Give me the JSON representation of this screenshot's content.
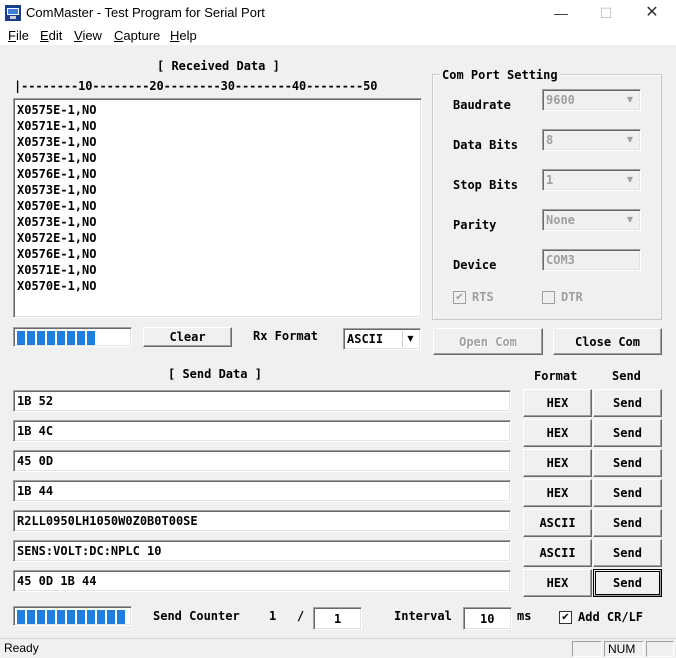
{
  "window": {
    "title": "ComMaster - Test Program for Serial Port",
    "min_glyph": "—",
    "max_glyph": "☐",
    "close_glyph": "✕",
    "icon": "serial-app-icon"
  },
  "menu": [
    {
      "accel": "F",
      "rest": "ile"
    },
    {
      "accel": "E",
      "rest": "dit"
    },
    {
      "accel": "V",
      "rest": "iew"
    },
    {
      "accel": "C",
      "rest": "apture"
    },
    {
      "accel": "H",
      "rest": "elp"
    }
  ],
  "received": {
    "heading": "[ Received Data ]",
    "ruler": "|--------10--------20--------30--------40--------50",
    "lines": [
      "X0575E-1,NO",
      "X0571E-1,NO",
      "X0573E-1,NO",
      "X0573E-1,NO",
      "X0576E-1,NO",
      "X0573E-1,NO",
      "X0570E-1,NO",
      "X0573E-1,NO",
      "X0572E-1,NO",
      "X0576E-1,NO",
      "X0571E-1,NO",
      "X0570E-1,NO"
    ],
    "progress": 0.72,
    "clear_label": "Clear",
    "rx_format_label": "Rx Format",
    "rx_format_value": "ASCII"
  },
  "com_port": {
    "group_title": "Com Port Setting",
    "baudrate_label": "Baudrate",
    "baudrate_value": "9600",
    "data_bits_label": "Data Bits",
    "data_bits_value": "8",
    "stop_bits_label": "Stop Bits",
    "stop_bits_value": "1",
    "parity_label": "Parity",
    "parity_value": "None",
    "device_label": "Device",
    "device_value": "COM3",
    "rts_label": "RTS",
    "rts_checked": true,
    "dtr_label": "DTR",
    "dtr_checked": false,
    "open_label": "Open Com",
    "close_label": "Close Com"
  },
  "send": {
    "heading": "[ Send Data ]",
    "format_header": "Format",
    "send_header": "Send",
    "rows": [
      {
        "data": "1B 52",
        "format": "HEX",
        "send": "Send"
      },
      {
        "data": "1B 4C",
        "format": "HEX",
        "send": "Send"
      },
      {
        "data": "45 0D",
        "format": "HEX",
        "send": "Send"
      },
      {
        "data": "1B 44",
        "format": "HEX",
        "send": "Send"
      },
      {
        "data": "R2LL0950LH1050W0Z0B0T00SE",
        "format": "ASCII",
        "send": "Send"
      },
      {
        "data": "SENS:VOLT:DC:NPLC 10",
        "format": "ASCII",
        "send": "Send"
      },
      {
        "data": "45 0D 1B 44",
        "format": "HEX",
        "send": "Send"
      }
    ],
    "progress": 1.0,
    "counter_label": "Send Counter",
    "counter_value": "1",
    "counter_sep": "/",
    "counter_total": "1",
    "interval_label": "Interval",
    "interval_value": "10",
    "interval_unit": "ms",
    "add_crlf_label": "Add CR/LF",
    "add_crlf_checked": true
  },
  "status": {
    "ready": "Ready",
    "num": "NUM"
  },
  "colors": {
    "progress_fill": "#1e7fe0"
  }
}
